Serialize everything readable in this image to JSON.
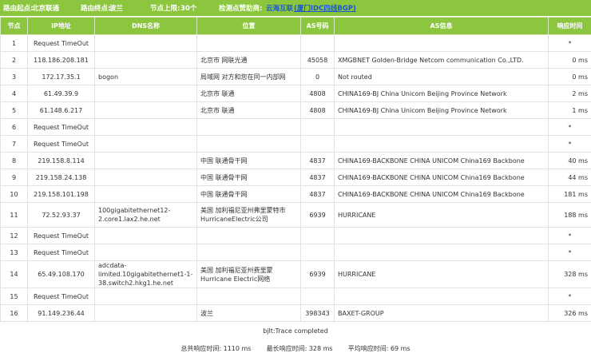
{
  "header": {
    "origin_label": "路由起点:",
    "origin_value": "北京联通",
    "dest_label": "路由终点:",
    "dest_value": "波兰",
    "max_hops_label": "节点上限:",
    "max_hops_value": "30个",
    "sponsor_label": "检测点赞助商:",
    "sponsor_name": "云海互联",
    "sponsor_link": "(厦门IDC四线BGP)"
  },
  "table": {
    "columns": [
      "节点",
      "IP地址",
      "DNS名称",
      "位置",
      "AS号码",
      "AS信息",
      "响应时间"
    ],
    "rows": [
      {
        "hop": "1",
        "ip": "Request TimeOut",
        "dns": "",
        "loc": "",
        "as": "",
        "info": "",
        "time": "*"
      },
      {
        "hop": "2",
        "ip": "118.186.208.181",
        "dns": "",
        "loc": "北京市 网联光通",
        "as": "45058",
        "info": "XMGBNET Golden-Bridge Netcom communication Co.,LTD.",
        "time": "0 ms"
      },
      {
        "hop": "3",
        "ip": "172.17.35.1",
        "dns": "bogon",
        "loc": "局域网 对方和您在同一内部网",
        "as": "0",
        "info": "Not routed",
        "time": "0 ms"
      },
      {
        "hop": "4",
        "ip": "61.49.39.9",
        "dns": "",
        "loc": "北京市 联通",
        "as": "4808",
        "info": "CHINA169-BJ China Unicom Beijing Province Network",
        "time": "2 ms"
      },
      {
        "hop": "5",
        "ip": "61.148.6.217",
        "dns": "",
        "loc": "北京市 联通",
        "as": "4808",
        "info": "CHINA169-BJ China Unicom Beijing Province Network",
        "time": "1 ms"
      },
      {
        "hop": "6",
        "ip": "Request TimeOut",
        "dns": "",
        "loc": "",
        "as": "",
        "info": "",
        "time": "*"
      },
      {
        "hop": "7",
        "ip": "Request TimeOut",
        "dns": "",
        "loc": "",
        "as": "",
        "info": "",
        "time": "*"
      },
      {
        "hop": "8",
        "ip": "219.158.8.114",
        "dns": "",
        "loc": "中国 联通骨干网",
        "as": "4837",
        "info": "CHINA169-BACKBONE CHINA UNICOM China169 Backbone",
        "time": "40 ms"
      },
      {
        "hop": "9",
        "ip": "219.158.24.138",
        "dns": "",
        "loc": "中国 联通骨干网",
        "as": "4837",
        "info": "CHINA169-BACKBONE CHINA UNICOM China169 Backbone",
        "time": "44 ms"
      },
      {
        "hop": "10",
        "ip": "219.158.101.198",
        "dns": "",
        "loc": "中国 联通骨干网",
        "as": "4837",
        "info": "CHINA169-BACKBONE CHINA UNICOM China169 Backbone",
        "time": "181 ms"
      },
      {
        "hop": "11",
        "ip": "72.52.93.37",
        "dns": "100gigabitethernet12-2.core1.lax2.he.net",
        "loc": "美国 加利福尼亚州弗里蒙特市HurricaneElectric公司",
        "as": "6939",
        "info": "HURRICANE",
        "time": "188 ms",
        "tall": true
      },
      {
        "hop": "12",
        "ip": "Request TimeOut",
        "dns": "",
        "loc": "",
        "as": "",
        "info": "",
        "time": "*"
      },
      {
        "hop": "13",
        "ip": "Request TimeOut",
        "dns": "",
        "loc": "",
        "as": "",
        "info": "",
        "time": "*"
      },
      {
        "hop": "14",
        "ip": "65.49.108.170",
        "dns": "adcdata-limited.10gigabitethernet1-1-38.switch2.hkg1.he.net",
        "loc": "美国 加利福尼亚州费里蒙Hurricane Electric网络",
        "as": "6939",
        "info": "HURRICANE",
        "time": "328 ms",
        "tall": true
      },
      {
        "hop": "15",
        "ip": "Request TimeOut",
        "dns": "",
        "loc": "",
        "as": "",
        "info": "",
        "time": "*"
      },
      {
        "hop": "16",
        "ip": "91.149.236.44",
        "dns": "",
        "loc": "波兰",
        "as": "398343",
        "info": "BAXET-GROUP",
        "time": "326 ms"
      }
    ]
  },
  "footer": {
    "trace_status": "bjlt:Trace completed",
    "total_label": "总共响应时间:",
    "total_value": "1110 ms",
    "max_label": "最长响应时间:",
    "max_value": "328 ms",
    "avg_label": "平均响应时间:",
    "avg_value": "69 ms"
  }
}
